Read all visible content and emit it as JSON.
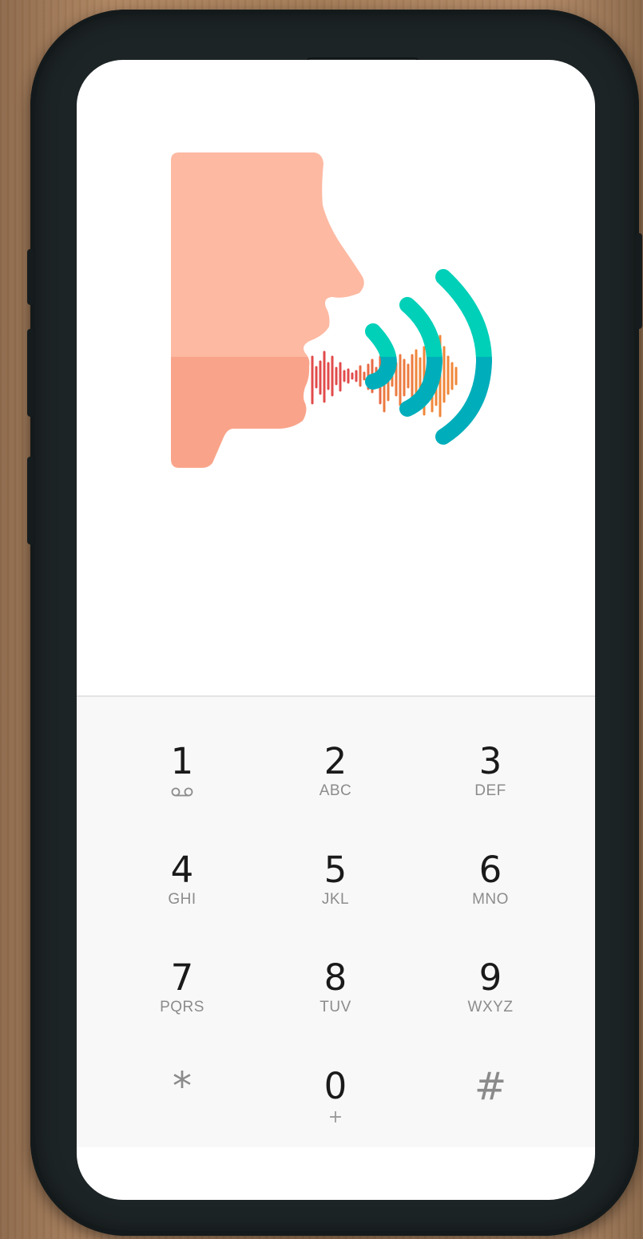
{
  "dialpad": {
    "keys": [
      {
        "digit": "1",
        "letters": "",
        "sub_icon": "voicemail-icon"
      },
      {
        "digit": "2",
        "letters": "ABC"
      },
      {
        "digit": "3",
        "letters": "DEF"
      },
      {
        "digit": "4",
        "letters": "GHI"
      },
      {
        "digit": "5",
        "letters": "JKL"
      },
      {
        "digit": "6",
        "letters": "MNO"
      },
      {
        "digit": "7",
        "letters": "PQRS"
      },
      {
        "digit": "8",
        "letters": "TUV"
      },
      {
        "digit": "9",
        "letters": "WXYZ"
      },
      {
        "digit": "*",
        "letters": ""
      },
      {
        "digit": "0",
        "letters": "+"
      },
      {
        "digit": "#",
        "letters": ""
      }
    ]
  },
  "illustration": {
    "name": "voice-speaking-illustration",
    "colors": {
      "face": "#fdb9a2",
      "face_lower": "#f9a48a",
      "waves": "#00d0b8",
      "waves_lower": "#00aebb",
      "audio_red": "#e24b4b",
      "audio_orange": "#f0873a"
    }
  },
  "theme": {
    "dialpad_bg": "#f8f8f8",
    "digit_color": "#1a1a1a",
    "letters_color": "#8c8c8c"
  }
}
